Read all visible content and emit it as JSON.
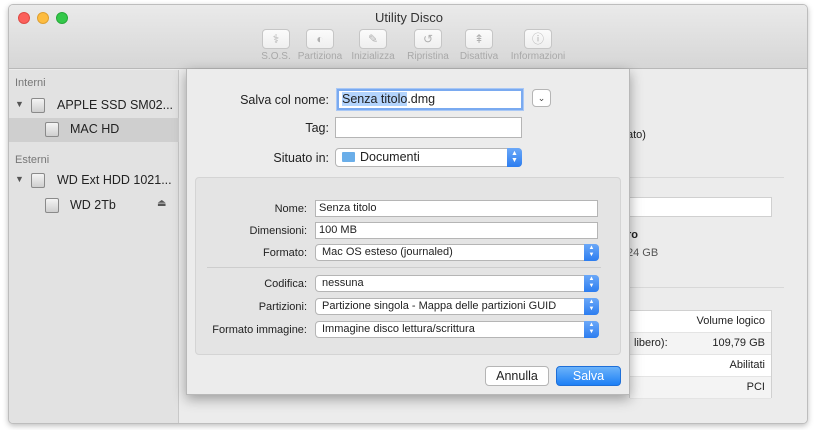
{
  "window": {
    "title": "Utility Disco"
  },
  "toolbar": {
    "buttons": [
      {
        "label": "S.O.S.",
        "icon": "stethoscope-icon",
        "glyph": "⚕"
      },
      {
        "label": "Partiziona",
        "icon": "partition-icon",
        "glyph": "◐"
      },
      {
        "label": "Inizializza",
        "icon": "erase-icon",
        "glyph": "✎"
      },
      {
        "label": "Ripristina",
        "icon": "restore-icon",
        "glyph": "↺"
      },
      {
        "label": "Disattiva",
        "icon": "unmount-icon",
        "glyph": "⇞"
      },
      {
        "label": "Informazioni",
        "icon": "info-icon",
        "glyph": "ⓘ"
      }
    ]
  },
  "sidebar": {
    "internal_header": "Interni",
    "external_header": "Esterni",
    "items": [
      {
        "label": "APPLE SSD SM02..."
      },
      {
        "label": "MAC HD"
      },
      {
        "label": "WD Ext HDD 1021..."
      },
      {
        "label": "WD 2Tb"
      }
    ]
  },
  "background": {
    "partial_text_1": "ato)",
    "partial_text_2": "ro",
    "partial_text_3": "24 GB",
    "table_rows": [
      {
        "left": "",
        "right": "Volume logico"
      },
      {
        "left": "libero):",
        "right": "109,79 GB"
      },
      {
        "left": "",
        "right": "Abilitati"
      },
      {
        "left": "",
        "right": "PCI"
      }
    ]
  },
  "sheet": {
    "save_as_label": "Salva col nome:",
    "save_as_selected": "Senza titolo",
    "save_as_ext": ".dmg",
    "tags_label": "Tag:",
    "tags_value": "",
    "where_label": "Situato in:",
    "where_value": "Documenti",
    "expand_glyph": "⌄",
    "options": {
      "name_label": "Nome:",
      "name_value": "Senza titolo",
      "size_label": "Dimensioni:",
      "size_value": "100 MB",
      "format_label": "Formato:",
      "format_value": "Mac OS esteso (journaled)",
      "encryption_label": "Codifica:",
      "encryption_value": "nessuna",
      "partitions_label": "Partizioni:",
      "partitions_value": "Partizione singola - Mappa delle partizioni GUID",
      "image_format_label": "Formato immagine:",
      "image_format_value": "Immagine disco lettura/scrittura"
    },
    "cancel_label": "Annulla",
    "save_label": "Salva"
  },
  "colors": {
    "accent": "#2c7df0",
    "selection": "#b3d4fd"
  }
}
